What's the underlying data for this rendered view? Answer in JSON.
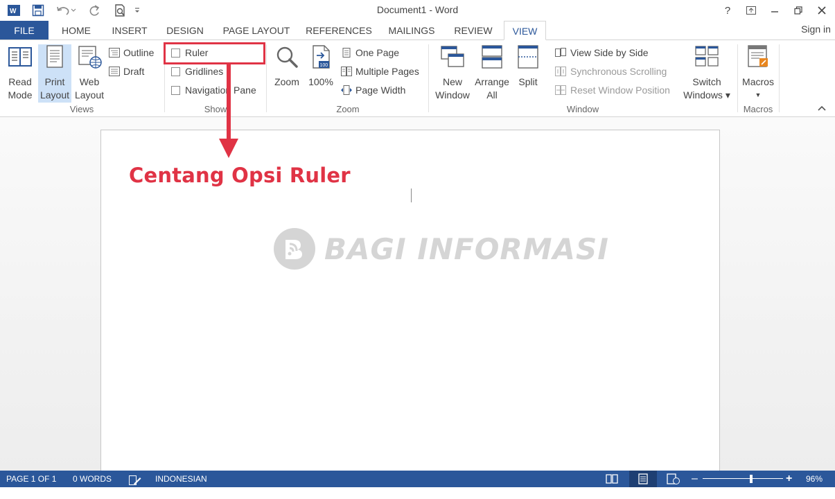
{
  "window": {
    "title": "Document1 - Word",
    "help": "?",
    "sign_in": "Sign in"
  },
  "tabs": [
    {
      "label": "FILE"
    },
    {
      "label": "HOME"
    },
    {
      "label": "INSERT"
    },
    {
      "label": "DESIGN"
    },
    {
      "label": "PAGE LAYOUT"
    },
    {
      "label": "REFERENCES"
    },
    {
      "label": "MAILINGS"
    },
    {
      "label": "REVIEW"
    },
    {
      "label": "VIEW"
    }
  ],
  "ribbon": {
    "views": {
      "label": "Views",
      "read_mode": [
        "Read",
        "Mode"
      ],
      "print_layout": [
        "Print",
        "Layout"
      ],
      "web_layout": [
        "Web",
        "Layout"
      ],
      "outline": "Outline",
      "draft": "Draft"
    },
    "show": {
      "label": "Show",
      "ruler": "Ruler",
      "gridlines": "Gridlines",
      "navigation_pane": "Navigation Pane"
    },
    "zoom": {
      "label": "Zoom",
      "zoom": "Zoom",
      "hundred": "100%",
      "one_page": "One Page",
      "multiple_pages": "Multiple Pages",
      "page_width": "Page Width"
    },
    "window": {
      "label": "Window",
      "new_window": [
        "New",
        "Window"
      ],
      "arrange_all": [
        "Arrange",
        "All"
      ],
      "split": "Split",
      "view_side_by_side": "View Side by Side",
      "synchronous_scrolling": "Synchronous Scrolling",
      "reset_window_position": "Reset Window Position",
      "switch_windows": [
        "Switch",
        "Windows ▾"
      ]
    },
    "macros": {
      "label": "Macros",
      "macros": "Macros"
    }
  },
  "document": {
    "annotation": "Centang Opsi Ruler",
    "watermark": "BAGI INFORMASI"
  },
  "status": {
    "page": "PAGE 1 OF 1",
    "words": "0 WORDS",
    "language": "INDONESIAN",
    "zoom": "96%",
    "zoom_fraction": 0.6
  },
  "colors": {
    "accent": "#2b579a",
    "annotation": "#e03345",
    "selected": "#cde1f7"
  }
}
